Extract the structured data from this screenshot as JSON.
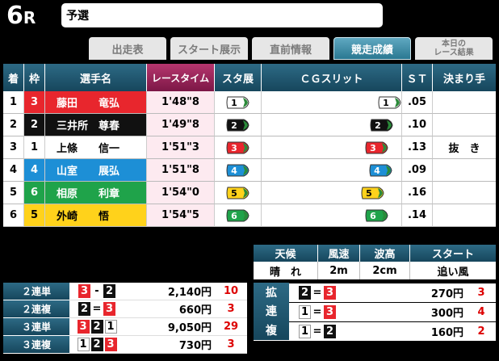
{
  "header": {
    "race_no": "6",
    "race_unit": "R",
    "title": "予選"
  },
  "tabs": [
    {
      "label": "出走表"
    },
    {
      "label": "スタート展示"
    },
    {
      "label": "直前情報"
    },
    {
      "label": "競走成績"
    },
    {
      "label": "本日の\nレース結果"
    }
  ],
  "columns": {
    "rank": "着",
    "frame": "枠",
    "name": "選手名",
    "time": "レースタイム",
    "st_exhibit": "スタ展",
    "cg_slit": "ＣＧスリット",
    "st": "ＳＴ",
    "kimarite": "決まり手"
  },
  "rows": [
    {
      "rank": "1",
      "frame": "3",
      "family": "藤田",
      "given": "竜弘",
      "time": "1'48\"8",
      "st": ".05",
      "kimarite": "",
      "exhibit_boat": "1",
      "slit_boat": "1"
    },
    {
      "rank": "2",
      "frame": "2",
      "family": "三井所",
      "given": "尊春",
      "time": "1'49\"8",
      "st": ".10",
      "kimarite": "",
      "exhibit_boat": "2",
      "slit_boat": "2"
    },
    {
      "rank": "3",
      "frame": "1",
      "family": "上條",
      "given": "信一",
      "time": "1'51\"3",
      "st": ".13",
      "kimarite": "抜　き",
      "exhibit_boat": "3",
      "slit_boat": "3"
    },
    {
      "rank": "4",
      "frame": "4",
      "family": "山室",
      "given": "展弘",
      "time": "1'51\"8",
      "st": ".09",
      "kimarite": "",
      "exhibit_boat": "4",
      "slit_boat": "4"
    },
    {
      "rank": "5",
      "frame": "6",
      "family": "相原",
      "given": "利章",
      "time": "1'54\"0",
      "st": ".16",
      "kimarite": "",
      "exhibit_boat": "5",
      "slit_boat": "5"
    },
    {
      "rank": "6",
      "frame": "5",
      "family": "外崎",
      "given": "悟",
      "time": "1'54\"5",
      "st": ".14",
      "kimarite": "",
      "exhibit_boat": "6",
      "slit_boat": "6"
    }
  ],
  "frame_colors": {
    "1": {
      "bg": "#ffffff",
      "fg": "#000000"
    },
    "2": {
      "bg": "#111111",
      "fg": "#ffffff"
    },
    "3": {
      "bg": "#e8262d",
      "fg": "#ffffff"
    },
    "4": {
      "bg": "#1d8fd6",
      "fg": "#ffffff"
    },
    "5": {
      "bg": "#ffd21b",
      "fg": "#000000"
    },
    "6": {
      "bg": "#1fa34a",
      "fg": "#ffffff"
    }
  },
  "weather": {
    "headers": [
      "天候",
      "風速",
      "波高",
      "スタート"
    ],
    "values": [
      "晴　れ",
      "2m",
      "2cm",
      "追い風"
    ]
  },
  "payouts_left": [
    {
      "label": "２連単",
      "boats": [
        "3",
        "2"
      ],
      "sep": [
        "-"
      ],
      "amount": "2,140円",
      "pop": "10"
    },
    {
      "label": "２連複",
      "boats": [
        "2",
        "3"
      ],
      "sep": [
        "="
      ],
      "amount": "660円",
      "pop": "3"
    },
    {
      "label": "３連単",
      "boats": [
        "3",
        "2",
        "1"
      ],
      "sep": [],
      "amount": "9,050円",
      "pop": "29"
    },
    {
      "label": "３連複",
      "boats": [
        "1",
        "2",
        "3"
      ],
      "sep": [],
      "amount": "730円",
      "pop": "3"
    }
  ],
  "payouts_right": {
    "label_chars": [
      "拡",
      "連",
      "複"
    ],
    "rows": [
      {
        "boats": [
          "2",
          "3"
        ],
        "sep": "=",
        "amount": "270円",
        "pop": "3"
      },
      {
        "boats": [
          "1",
          "3"
        ],
        "sep": "=",
        "amount": "300円",
        "pop": "4"
      },
      {
        "boats": [
          "1",
          "2"
        ],
        "sep": "=",
        "amount": "160円",
        "pop": "2"
      }
    ]
  },
  "colors": {
    "header_blue": "#1f5a75",
    "pink_header": "#9c2257",
    "popularity": "#dd0000"
  }
}
